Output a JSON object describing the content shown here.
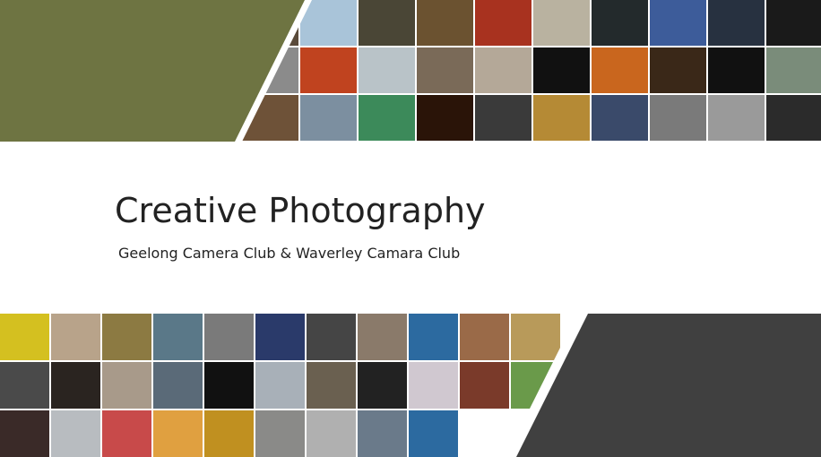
{
  "slide": {
    "title": "Creative Photography",
    "subtitle": "Geelong Camera Club & Waverley Camara Club"
  },
  "colors": {
    "olive_shape": "#6e7442",
    "dark_shape": "#404040",
    "background": "#ffffff",
    "text": "#222222"
  },
  "top_collage": {
    "thumbnails": [
      "#5a4a3a",
      "#a9c4d9",
      "#4a4636",
      "#6b5230",
      "#a8321f",
      "#b9b2a0",
      "#232a2c",
      "#3d5c9a",
      "#273140",
      "#1a1a1a",
      "#8b8b8b",
      "#c0431f",
      "#b9c3c8",
      "#7a6a58",
      "#b4a898",
      "#111111",
      "#c9661e",
      "#3a2818",
      "#111111",
      "#7a8c7a",
      "#6e5238",
      "#7c8fa0",
      "#3c8a5a",
      "#2a1408",
      "#3a3a3a",
      "#b58a35",
      "#3a4a6a",
      "#7a7a7a",
      "#9a9a9a",
      "#2b2b2b"
    ]
  },
  "bottom_collage": {
    "thumbnails": [
      "#d4c020",
      "#b8a38a",
      "#8c7a42",
      "#5a7888",
      "#7a7a7a",
      "#2a3a6a",
      "#454545",
      "#8a7a6a",
      "#2c6aa0",
      "#9a6a48",
      "#b89a5a",
      "#4a4a4a",
      "#2a2420",
      "#a89a8a",
      "#5a6a78",
      "#111111",
      "#a8b0b8",
      "#6a6050",
      "#222222",
      "#d0c8d0",
      "#7a3a2a",
      "#6a9a4a",
      "#3a2a28",
      "#b8bcc0",
      "#c84a4a",
      "#e0a040",
      "#c09020",
      "#8a8a88",
      "#b0b0b0",
      "#6a7a8a",
      "#2c6aa0",
      "#ffffff",
      "#ffffff"
    ]
  }
}
